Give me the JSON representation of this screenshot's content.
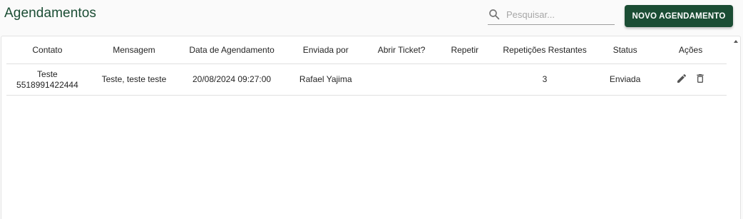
{
  "header": {
    "title": "Agendamentos",
    "search_placeholder": "Pesquisar...",
    "search_value": "",
    "new_button_label": "NOVO AGENDAMENTO"
  },
  "colors": {
    "brand": "#1b4d34",
    "title": "#1b4d34"
  },
  "table": {
    "columns": [
      "Contato",
      "Mensagem",
      "Data de Agendamento",
      "Enviada por",
      "Abrir Ticket?",
      "Repetir",
      "Repetições Restantes",
      "Status",
      "Ações"
    ],
    "rows": [
      {
        "contact_name": "Teste",
        "contact_number": "5518991422444",
        "message": "Teste, teste teste",
        "scheduled_at": "20/08/2024 09:27:00",
        "sent_by": "Rafael Yajima",
        "open_ticket": "",
        "repeat": "",
        "remaining_repeats": "3",
        "status": "Enviada",
        "actions": [
          "edit-icon",
          "delete-icon"
        ]
      }
    ]
  }
}
